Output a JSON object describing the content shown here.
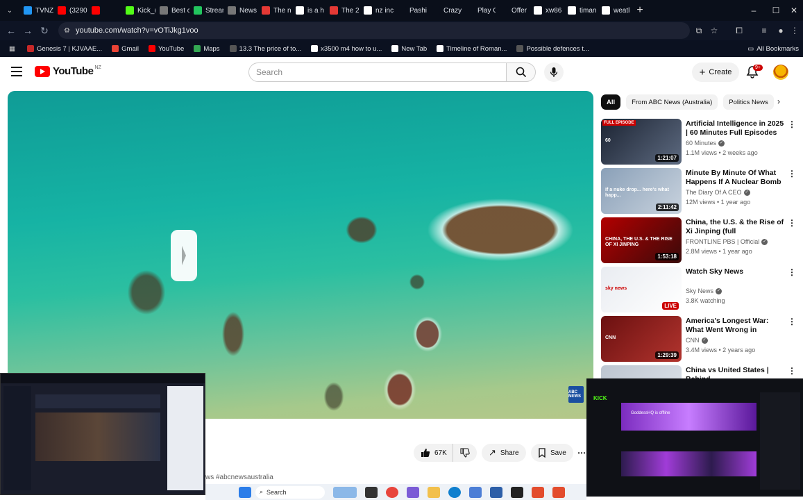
{
  "browser": {
    "tabs": [
      {
        "label": "TVNZ",
        "color": "#2196f3"
      },
      {
        "label": "(3290",
        "color": "#ff0000"
      },
      {
        "label": "",
        "color": "#ff0000"
      },
      {
        "label": "Kick_(",
        "color": "#53fc18"
      },
      {
        "label": "Best c",
        "color": "#777777"
      },
      {
        "label": "Strean",
        "color": "#22c55e"
      },
      {
        "label": "News",
        "color": "#777777"
      },
      {
        "label": "The n",
        "color": "#e53935"
      },
      {
        "label": "is a h",
        "color": "#ffffff"
      },
      {
        "label": "The 2",
        "color": "#e53935"
      },
      {
        "label": "nz inc",
        "color": "#ffffff"
      },
      {
        "label": "Pashi",
        "color": "#0a0f1a"
      },
      {
        "label": "Crazy",
        "color": "#0a0f1a"
      },
      {
        "label": "Play C",
        "color": "#0a0f1a"
      },
      {
        "label": "Offer",
        "color": "#0a0f1a"
      },
      {
        "label": "xw86",
        "color": "#ffffff"
      },
      {
        "label": "timan",
        "color": "#ffffff"
      },
      {
        "label": "weatl",
        "color": "#ffffff"
      }
    ],
    "url": "youtube.com/watch?v=vOTiJkg1voo",
    "bookmarks": [
      {
        "label": "Genesis 7 | KJVAAE...",
        "color": "#c62828"
      },
      {
        "label": "Gmail",
        "color": "#ea4335"
      },
      {
        "label": "YouTube",
        "color": "#ff0000"
      },
      {
        "label": "Maps",
        "color": "#34a853"
      },
      {
        "label": "13.3 The price of to...",
        "color": "#555555"
      },
      {
        "label": "x3500 m4 how to u...",
        "color": "#ffffff"
      },
      {
        "label": "New Tab",
        "color": "#ffffff"
      },
      {
        "label": "Timeline of Roman...",
        "color": "#ffffff"
      },
      {
        "label": "Possible defences t...",
        "color": "#555555"
      }
    ],
    "all_bookmarks": "All Bookmarks"
  },
  "yt": {
    "logo_text": "YouTube",
    "country": "NZ",
    "search_placeholder": "Search",
    "create_label": "Create",
    "notif_badge": "9+",
    "chips": [
      "All",
      "From ABC News (Australia)",
      "Politics News"
    ],
    "recommended": [
      {
        "title": "Artificial Intelligence in 2025 | 60 Minutes Full Episodes",
        "channel": "60 Minutes",
        "verified": true,
        "meta": "1.1M views • 2 weeks ago",
        "duration": "1:21:07",
        "tag": "FULL EPISODE",
        "thumb_text": "60",
        "thumb_colors": [
          "#1c2433",
          "#5d6a80"
        ]
      },
      {
        "title": "Minute By Minute Of What Happens If A Nuclear Bomb ...",
        "channel": "The Diary Of A CEO",
        "verified": true,
        "meta": "12M views • 1 year ago",
        "duration": "2:11:42",
        "thumb_text": "if a nuke drop... here's what happ...",
        "thumb_colors": [
          "#8aa0b8",
          "#c9d3de"
        ]
      },
      {
        "title": "China, the U.S. & the Rise of Xi Jinping (full documentary) | ...",
        "channel": "FRONTLINE PBS | Official",
        "verified": true,
        "meta": "2.8M views • 1 year ago",
        "duration": "1:53:18",
        "thumb_text": "CHINA, THE U.S. & THE RISE OF XI JINPING",
        "thumb_colors": [
          "#b30000",
          "#3a0a0a"
        ]
      },
      {
        "title": "Watch Sky News",
        "channel": "Sky News",
        "verified": true,
        "meta": "3.8K watching",
        "live": "LIVE",
        "thumb_text": "sky news",
        "thumb_colors": [
          "#e9ecf1",
          "#ffffff"
        ]
      },
      {
        "title": "America's Longest War: What Went Wrong in Afghanistan ...",
        "channel": "CNN",
        "verified": true,
        "meta": "3.4M views • 2 years ago",
        "duration": "1:29:39",
        "thumb_text": "CNN",
        "thumb_colors": [
          "#6b1010",
          "#b2342e"
        ]
      },
      {
        "title": "China vs United States | Behind",
        "channel": "",
        "verified": false,
        "meta": "",
        "thumb_text": "",
        "thumb_colors": [
          "#bcc5d0",
          "#e0e5ec"
        ]
      }
    ],
    "actions": {
      "likes": "67K",
      "share": "Share",
      "save": "Save"
    },
    "hashtags_fragment": "ws #abcnewsaustralia",
    "player": {
      "watermark": "ABC NEWS"
    }
  },
  "taskbar": {
    "search_label": "Search"
  },
  "overlays": {
    "right_banner": "GoddessHQ is offline",
    "right_logo": "KICK"
  }
}
